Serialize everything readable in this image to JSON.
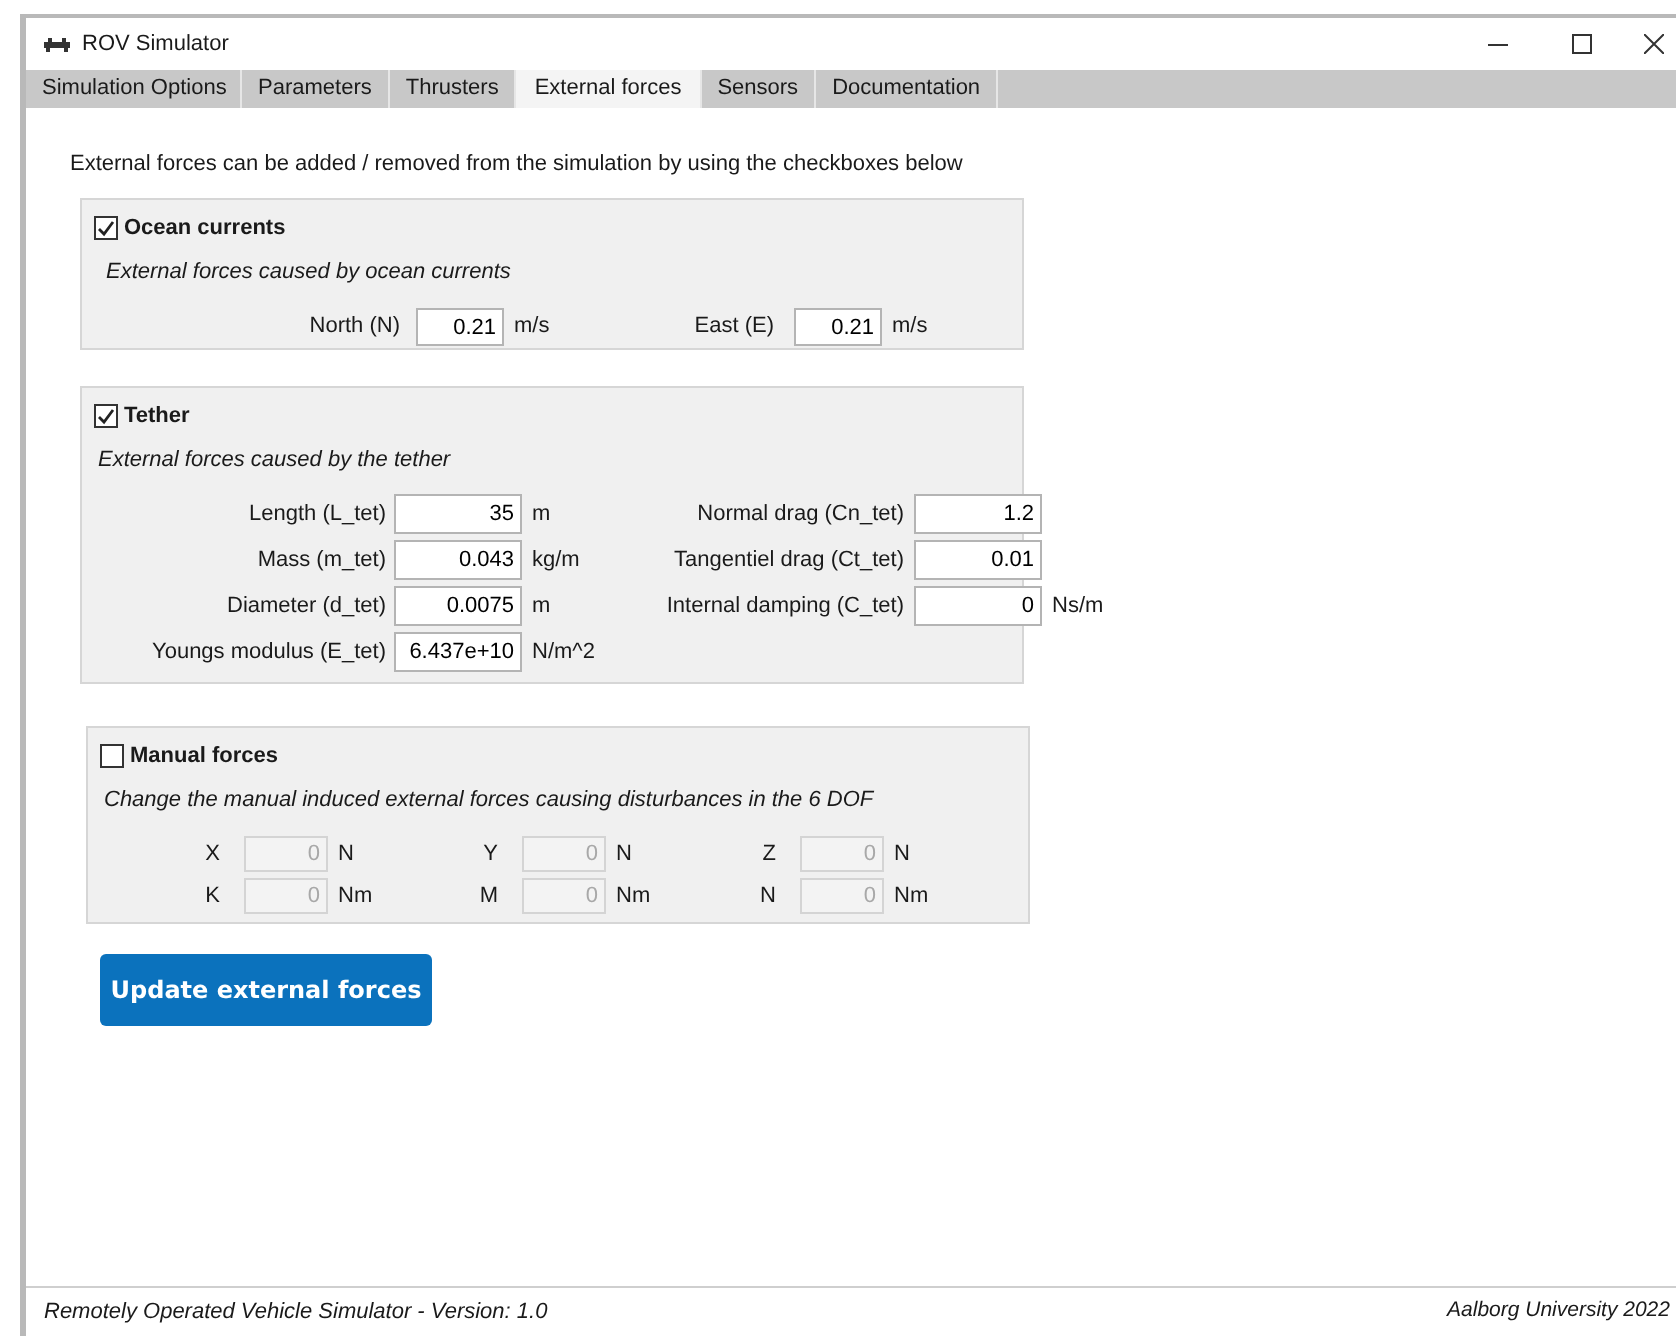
{
  "window": {
    "title": "ROV Simulator"
  },
  "tabs": [
    {
      "label": "Simulation Options",
      "selected": false
    },
    {
      "label": "Parameters",
      "selected": false
    },
    {
      "label": "Thrusters",
      "selected": false
    },
    {
      "label": "External forces",
      "selected": true
    },
    {
      "label": "Sensors",
      "selected": false
    },
    {
      "label": "Documentation",
      "selected": false
    }
  ],
  "intro": "External forces can be added / removed from the simulation by using the checkboxes below",
  "sections": [
    {
      "kind": "ocean",
      "title": "Ocean currents",
      "checked": true,
      "description": "External forces caused by ocean currents",
      "columns": [
        [
          {
            "label": "North (N)",
            "value": "0.21",
            "unit": "m/s"
          }
        ],
        [
          {
            "label": "East (E)",
            "value": "0.21",
            "unit": "m/s"
          }
        ]
      ]
    },
    {
      "kind": "tether",
      "title": "Tether",
      "checked": true,
      "description": "External forces caused by the tether",
      "columns": [
        [
          {
            "label": "Length (L_tet)",
            "value": "35",
            "unit": "m"
          },
          {
            "label": "Mass (m_tet)",
            "value": "0.043",
            "unit": "kg/m"
          },
          {
            "label": "Diameter (d_tet)",
            "value": "0.0075",
            "unit": "m"
          },
          {
            "label": "Youngs modulus (E_tet)",
            "value": "6.437e+10",
            "unit": "N/m^2"
          }
        ],
        [
          {
            "label": "Normal drag (Cn_tet)",
            "value": "1.2"
          },
          {
            "label": "Tangentiel drag (Ct_tet)",
            "value": "0.01"
          },
          {
            "label": "Internal damping (C_tet)",
            "value": "0",
            "unit": "Ns/m"
          }
        ]
      ]
    },
    {
      "kind": "manual",
      "title": "Manual forces",
      "checked": false,
      "description": "Change the manual induced external forces causing disturbances in the 6 DOF",
      "columns": [
        [
          {
            "label": "X",
            "value": "0",
            "unit": "N"
          },
          {
            "label": "K",
            "value": "0",
            "unit": "Nm"
          }
        ],
        [
          {
            "label": "Y",
            "value": "0",
            "unit": "N"
          },
          {
            "label": "M",
            "value": "0",
            "unit": "Nm"
          }
        ],
        [
          {
            "label": "Z",
            "value": "0",
            "unit": "N"
          },
          {
            "label": "N",
            "value": "0",
            "unit": "Nm"
          }
        ]
      ]
    }
  ],
  "update_button": "Update external forces",
  "status_bar": {
    "left": "Remotely Operated Vehicle Simulator - Version: 1.0",
    "right": "Aalborg University 2022"
  }
}
